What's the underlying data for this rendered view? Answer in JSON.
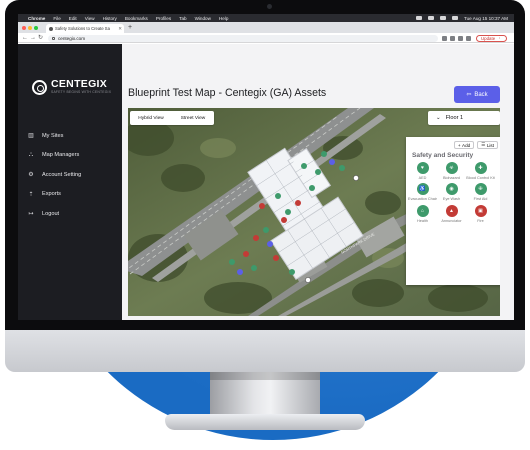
{
  "menubar": {
    "app": "Chrome",
    "items": [
      "File",
      "Edit",
      "View",
      "History",
      "Bookmarks",
      "Profiles",
      "Tab",
      "Window",
      "Help"
    ],
    "clock": "Tue Aug 15  10:37 AM"
  },
  "browser": {
    "tab_title": "Safety Solutions to Create Sa",
    "url": "centegix.com",
    "update_label": "Update"
  },
  "sidebar": {
    "logo_text": "CENTEGIX",
    "logo_tagline": "SAFETY BEGINS WITH CENTEGIX",
    "items": [
      {
        "label": "My Sites",
        "icon": "building-icon"
      },
      {
        "label": "Map Managers",
        "icon": "users-icon"
      },
      {
        "label": "Account Setting",
        "icon": "gear-icon"
      },
      {
        "label": "Exports",
        "icon": "export-icon"
      },
      {
        "label": "Logout",
        "icon": "logout-icon"
      }
    ]
  },
  "main": {
    "title": "Blueprint Test Map - Centegix (GA) Assets",
    "back_label": "Back"
  },
  "map": {
    "view_options": [
      "Hybrid View",
      "Street View"
    ],
    "floor": "Floor 1",
    "road_label": "NORTHPARK DRIVE"
  },
  "asset_panel": {
    "add_label": "Add",
    "list_label": "List",
    "title": "Safety and Security",
    "assets": [
      {
        "label": "AED",
        "icon": "heart-icon",
        "color": "green"
      },
      {
        "label": "Biohazard",
        "icon": "biohazard-icon",
        "color": "green"
      },
      {
        "label": "Blood Control Kit",
        "icon": "bleeding-icon",
        "color": "green"
      },
      {
        "label": "Evacuation Chair",
        "icon": "wheelchair-icon",
        "color": "green"
      },
      {
        "label": "Eye Wash",
        "icon": "eye-wash-icon",
        "color": "green"
      },
      {
        "label": "First Aid",
        "icon": "first-aid-icon",
        "color": "green"
      },
      {
        "label": "Health",
        "icon": "health-icon",
        "color": "green"
      },
      {
        "label": "Annunciator",
        "icon": "annunciator-icon",
        "color": "red"
      },
      {
        "label": "Fire",
        "icon": "fire-icon",
        "color": "red"
      }
    ]
  },
  "colors": {
    "accent": "#5b5fe8",
    "sidebar_bg": "#1c1d22",
    "marker_green": "#3e9a6b",
    "marker_red": "#c33b36",
    "backdrop_blue": "#1d77d9"
  }
}
